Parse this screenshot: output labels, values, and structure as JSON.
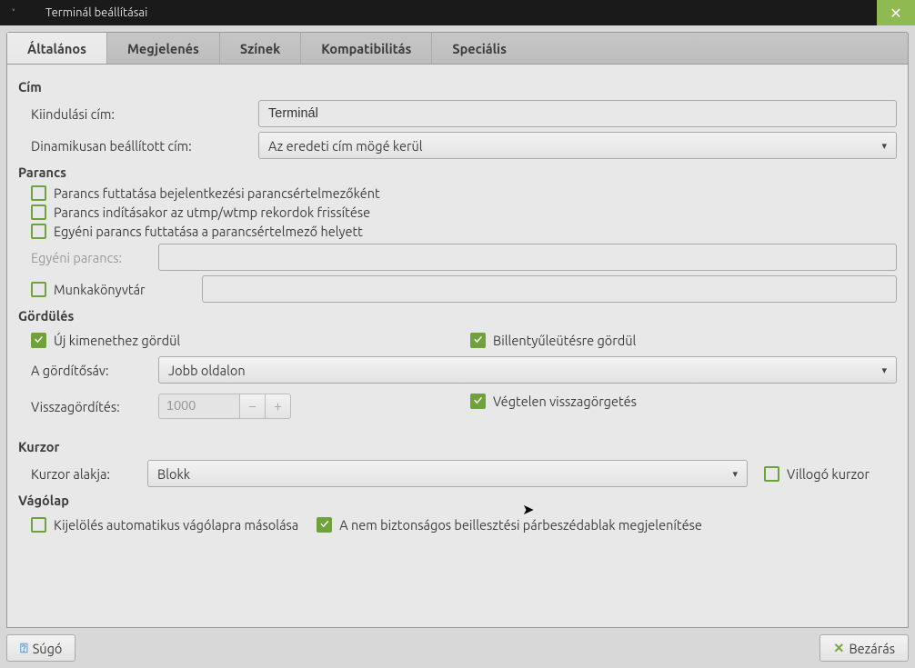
{
  "titlebar": {
    "title": "Terminál beállításai"
  },
  "tabs": {
    "general": "Általános",
    "appearance": "Megjelenés",
    "colors": "Színek",
    "compat": "Kompatibilitás",
    "special": "Speciális"
  },
  "title_section": {
    "heading": "Cím",
    "initial_title_label": "Kiindulási cím:",
    "initial_title_value": "Terminál",
    "dynamic_title_label": "Dinamikusan beállított cím:",
    "dynamic_title_value": "Az eredeti cím mögé kerül"
  },
  "command_section": {
    "heading": "Parancs",
    "login_shell": "Parancs futtatása bejelentkezési parancsértelmezőként",
    "update_utmp": "Parancs indításakor az utmp/wtmp rekordok frissítése",
    "custom_cmd_chk": "Egyéni parancs futtatása a parancsértelmező helyett",
    "custom_cmd_label": "Egyéni parancs:",
    "workdir": "Munkakönyvtár"
  },
  "scroll_section": {
    "heading": "Gördülés",
    "scroll_output": "Új kimenethez gördül",
    "scroll_keystroke": "Billentyűleütésre gördül",
    "scrollbar_label": "A gördítősáv:",
    "scrollbar_value": "Jobb oldalon",
    "scrollback_label": "Visszagördítés:",
    "scrollback_value": "1000",
    "unlimited": "Végtelen visszagörgetés"
  },
  "cursor_section": {
    "heading": "Kurzor",
    "shape_label": "Kurzor alakja:",
    "shape_value": "Blokk",
    "blinking": "Villogó kurzor"
  },
  "clipboard_section": {
    "heading": "Vágólap",
    "auto_copy": "Kijelölés automatikus vágólapra másolása",
    "unsafe_paste": "A nem biztonságos beillesztési párbeszédablak megjelenítése"
  },
  "footer": {
    "help": "Súgó",
    "close": "Bezárás"
  }
}
